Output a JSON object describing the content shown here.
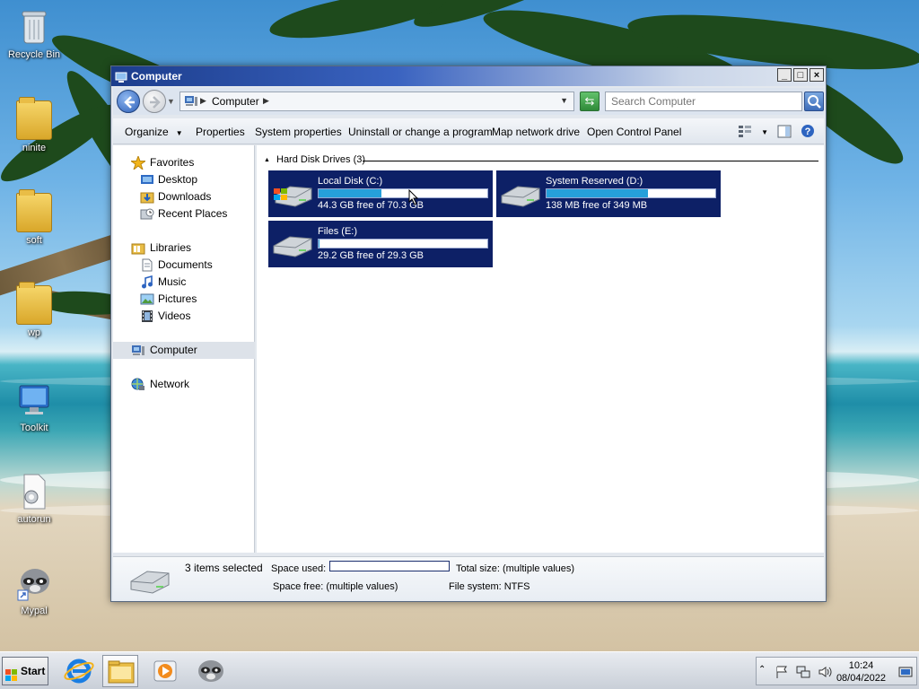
{
  "desktop": {
    "icons": [
      {
        "label": "Recycle Bin",
        "icon": "recycle-bin-icon"
      },
      {
        "label": "ninite",
        "icon": "folder-icon"
      },
      {
        "label": "soft",
        "icon": "folder-icon"
      },
      {
        "label": "wp",
        "icon": "folder-icon"
      },
      {
        "label": "Toolkit",
        "icon": "computer-monitor-icon"
      },
      {
        "label": "autorun",
        "icon": "settings-file-icon"
      },
      {
        "label": "Mypal",
        "icon": "raccoon-shortcut-icon"
      }
    ]
  },
  "window": {
    "title": "Computer",
    "controls": {
      "minimize": "_",
      "maximize": "□",
      "close": "×"
    }
  },
  "address": {
    "crumb": "Computer",
    "search_placeholder": "Search Computer"
  },
  "toolbar": {
    "organize": "Organize",
    "properties": "Properties",
    "system_properties": "System properties",
    "uninstall": "Uninstall or change a program",
    "map_drive": "Map network drive",
    "control_panel": "Open Control Panel"
  },
  "nav": {
    "favorites": "Favorites",
    "desktop": "Desktop",
    "downloads": "Downloads",
    "recent": "Recent Places",
    "libraries": "Libraries",
    "documents": "Documents",
    "music": "Music",
    "pictures": "Pictures",
    "videos": "Videos",
    "computer": "Computer",
    "network": "Network"
  },
  "content": {
    "group_label": "Hard Disk Drives (3)",
    "drives": [
      {
        "name": "Local Disk (C:)",
        "free_text": "44.3 GB free of 70.3 GB",
        "used_fraction": 0.37,
        "icon": "windows-drive-icon",
        "bar_color": "#26a0da"
      },
      {
        "name": "System Reserved (D:)",
        "free_text": "138 MB free of 349 MB",
        "used_fraction": 0.6,
        "icon": "hard-drive-icon",
        "bar_color": "#26a0da"
      },
      {
        "name": "Files (E:)",
        "free_text": "29.2 GB free of 29.3 GB",
        "used_fraction": 0.003,
        "icon": "hard-drive-icon",
        "bar_color": "#26a0da"
      }
    ]
  },
  "details": {
    "selected": "3 items selected",
    "space_used_label": "Space used:",
    "total_size": "Total size: (multiple values)",
    "space_free": "Space free: (multiple values)",
    "file_system": "File system: NTFS"
  },
  "taskbar": {
    "start": "Start",
    "apps": [
      "internet-explorer-icon",
      "windows-explorer-icon",
      "media-player-icon",
      "mypal-browser-icon"
    ],
    "time": "10:24",
    "date": "08/04/2022"
  }
}
